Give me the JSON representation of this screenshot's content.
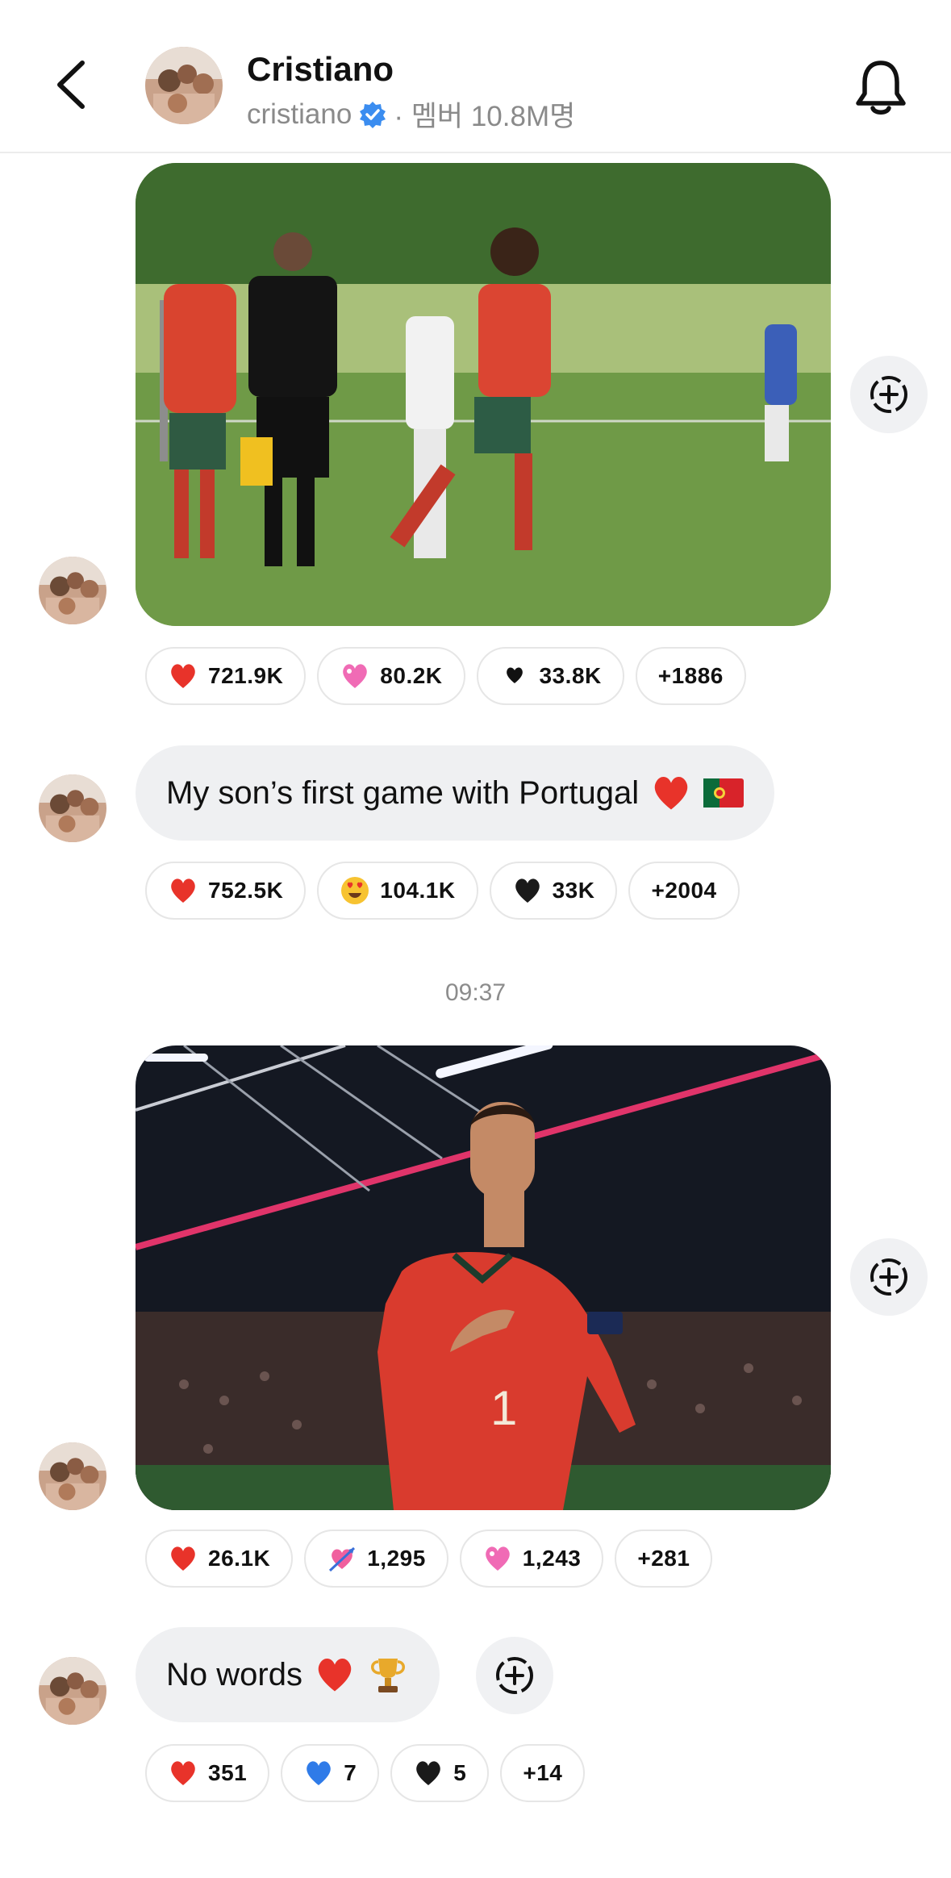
{
  "header": {
    "name": "Cristiano",
    "handle": "cristiano",
    "members": "· 멤버 10.8M명"
  },
  "messages": [
    {
      "type": "photo",
      "description_icon": "photo",
      "reactions": [
        {
          "emoji": "red-heart",
          "count": "721.9K"
        },
        {
          "emoji": "pink-heart",
          "count": "80.2K"
        },
        {
          "emoji": "black-heart-small",
          "count": "33.8K"
        },
        {
          "emoji": "",
          "count": "+1886"
        }
      ]
    },
    {
      "type": "text",
      "text": "My son’s first game with Portugal",
      "reactions": [
        {
          "emoji": "red-heart",
          "count": "752.5K"
        },
        {
          "emoji": "heart-eyes",
          "count": "104.1K"
        },
        {
          "emoji": "black-heart",
          "count": "33K"
        },
        {
          "emoji": "",
          "count": "+2004"
        }
      ]
    },
    {
      "type": "timestamp",
      "time": "09:37"
    },
    {
      "type": "photo",
      "reactions": [
        {
          "emoji": "red-heart",
          "count": "26.1K"
        },
        {
          "emoji": "heart-arrow",
          "count": "1,295"
        },
        {
          "emoji": "pink-heart",
          "count": "1,243"
        },
        {
          "emoji": "",
          "count": "+281"
        }
      ]
    },
    {
      "type": "text",
      "text": "No words",
      "reactions": [
        {
          "emoji": "red-heart",
          "count": "351"
        },
        {
          "emoji": "blue-heart",
          "count": "7"
        },
        {
          "emoji": "black-heart",
          "count": "5"
        },
        {
          "emoji": "",
          "count": "+14"
        }
      ]
    }
  ],
  "colors": {
    "bubble": "#eff0f2",
    "verified": "#3b8df0",
    "muted_text": "#8a8a8a"
  }
}
